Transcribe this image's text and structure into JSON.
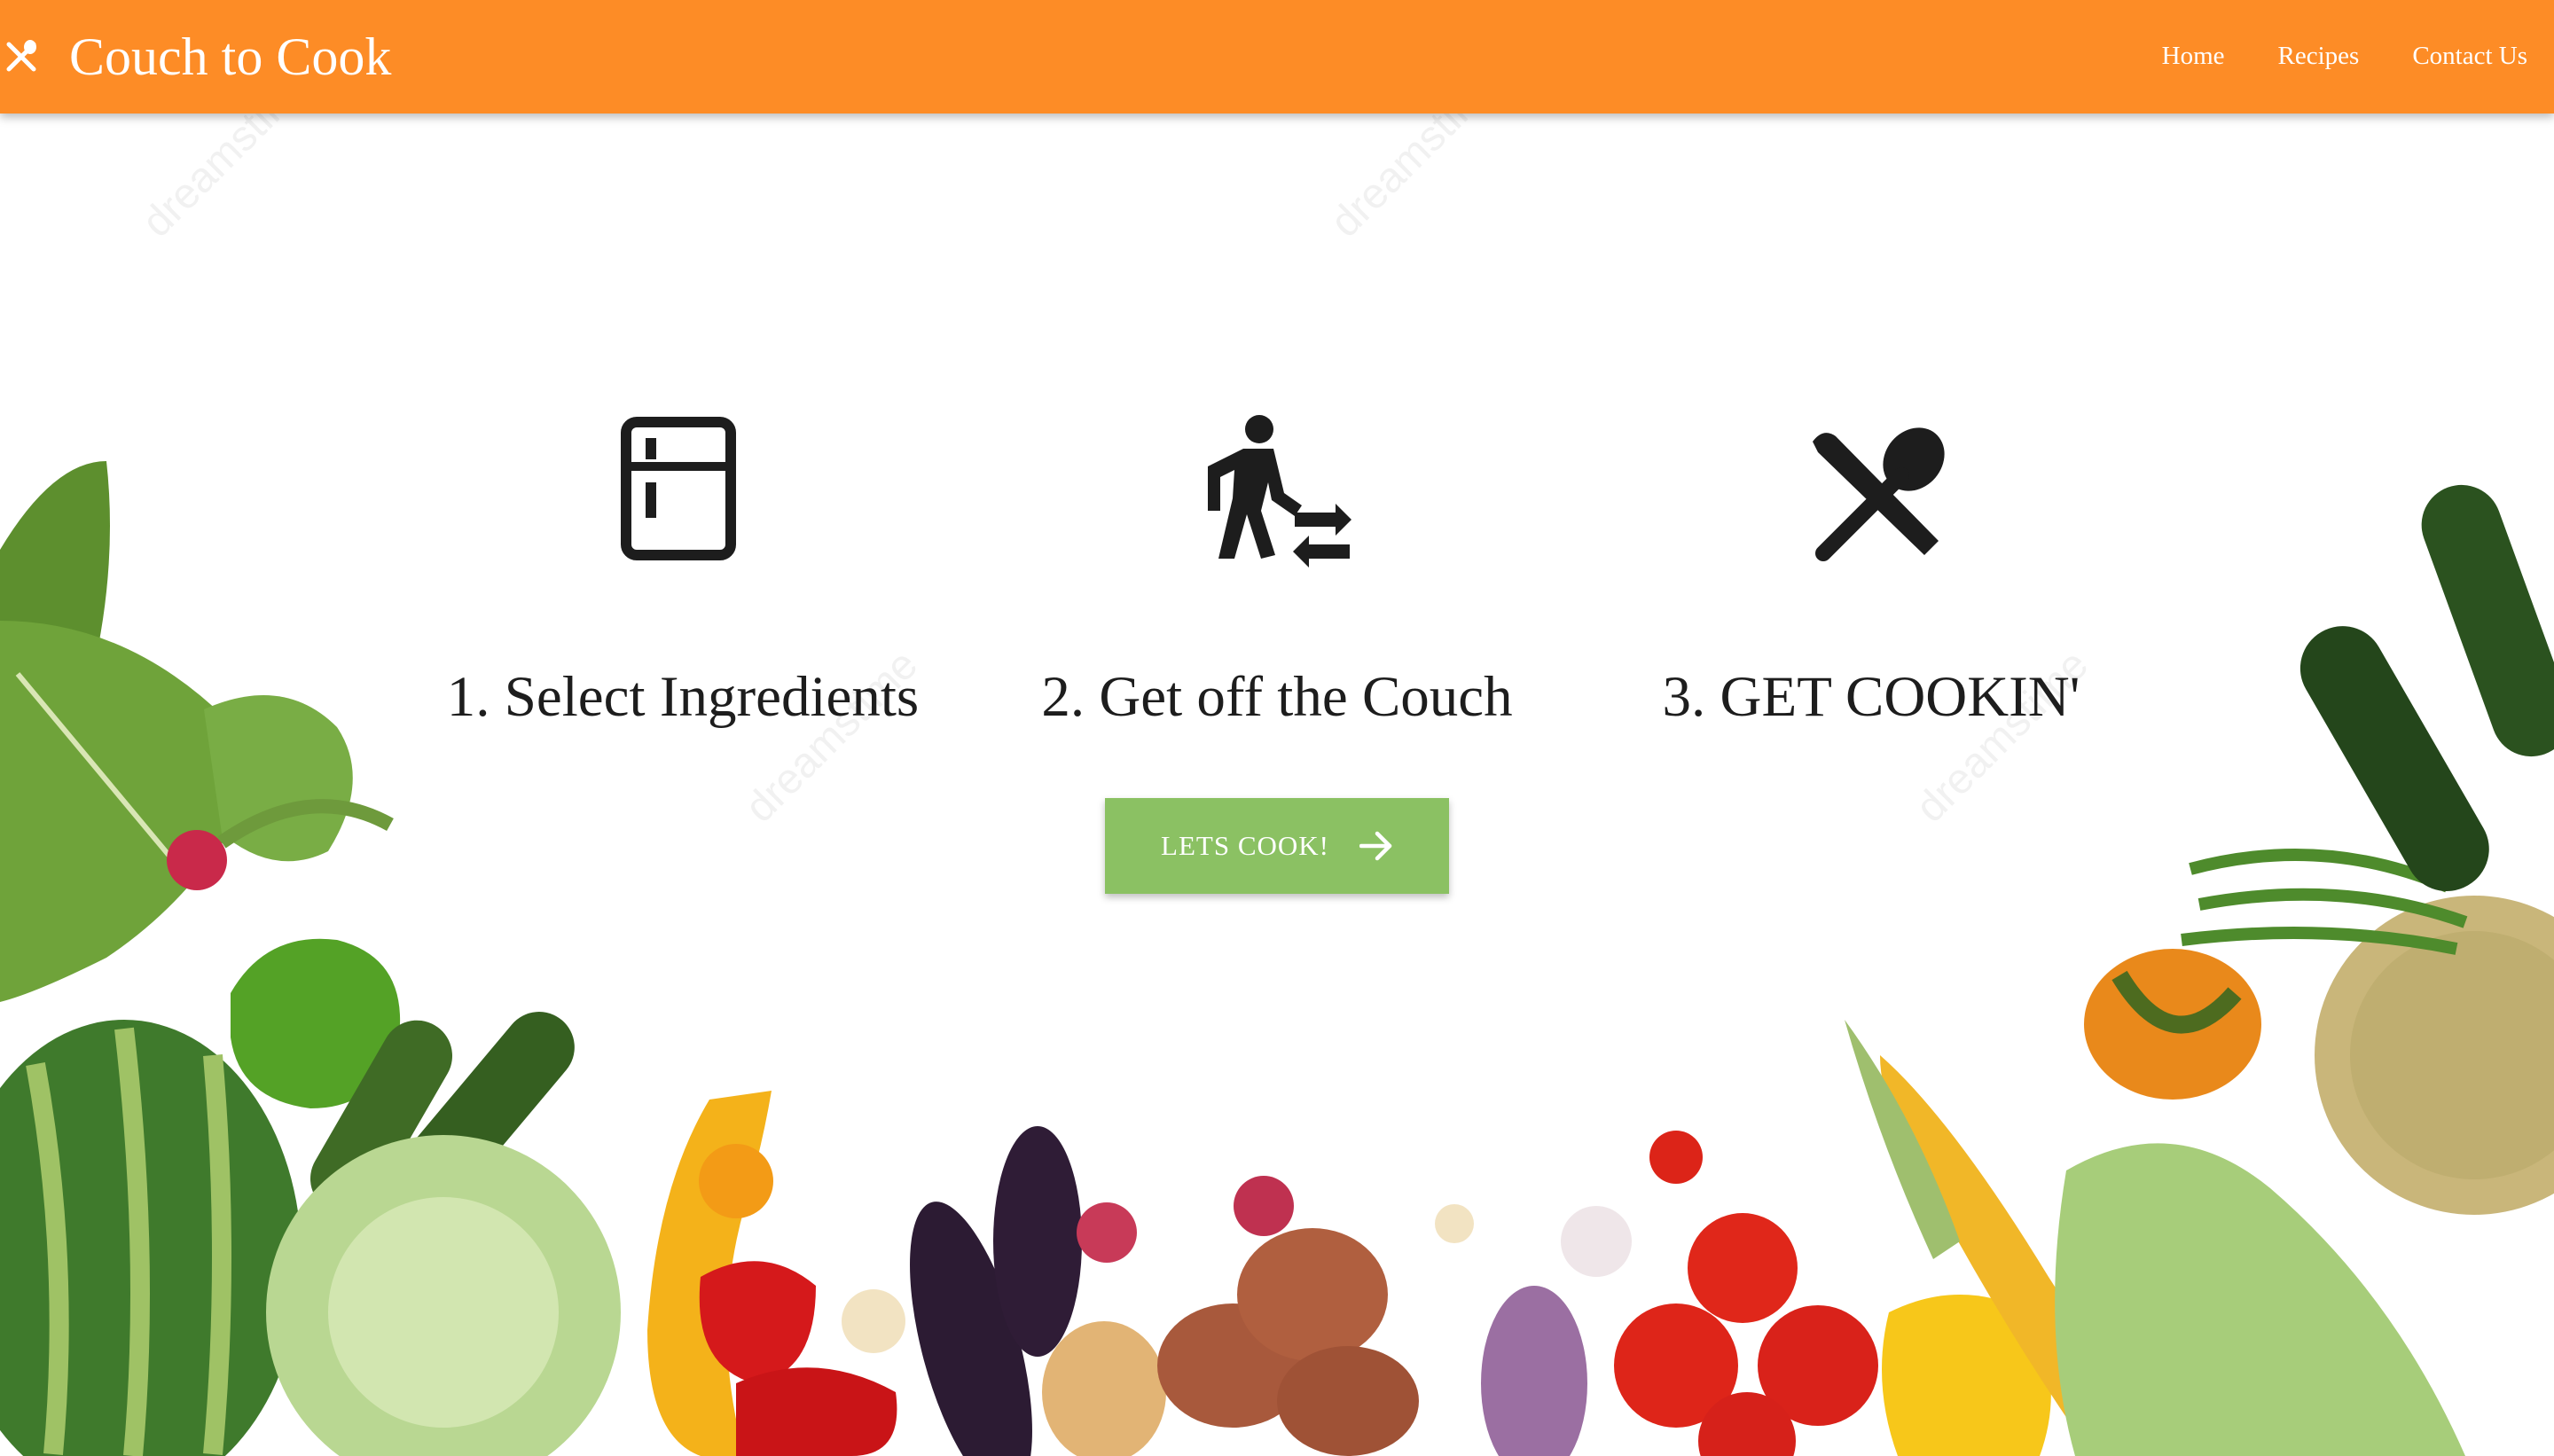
{
  "header": {
    "brand_icon": "fork-spoon-icon",
    "title": "Couch to Cook",
    "nav": [
      {
        "label": "Home"
      },
      {
        "label": "Recipes"
      },
      {
        "label": "Contact Us"
      }
    ]
  },
  "steps": [
    {
      "icon": "fridge-icon",
      "label": "1. Select Ingredients"
    },
    {
      "icon": "walking-person-transfer-icon",
      "label": "2. Get off the Couch"
    },
    {
      "icon": "fork-spoon-icon",
      "label": "3. GET COOKIN'"
    }
  ],
  "cta": {
    "label": "LETS COOK!",
    "icon": "arrow-right-icon"
  },
  "watermark": {
    "text": "dreamstime"
  },
  "colors": {
    "header": "#fd8c26",
    "cta": "#8bc163",
    "text": "#1d1d1d"
  }
}
